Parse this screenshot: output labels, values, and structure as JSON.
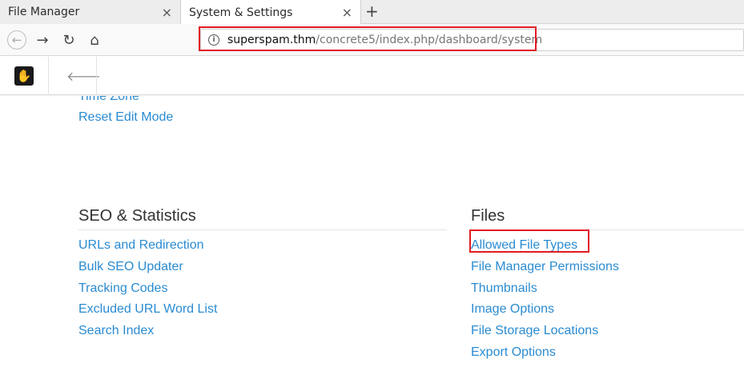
{
  "browser": {
    "tabs": [
      {
        "label": "File Manager",
        "close": "×"
      },
      {
        "label": "System & Settings",
        "close": "×"
      }
    ],
    "new_tab": "+",
    "nav": {
      "back": "←",
      "forward": "→",
      "reload": "↻",
      "home": "⌂"
    },
    "url_host": "superspam.thm",
    "url_path": "/concrete5/index.php/dashboard/system",
    "info_icon": "i"
  },
  "toolbar": {
    "logo": "✋",
    "back": "🡐"
  },
  "previous_section": {
    "links": [
      "Time Zone",
      "Reset Edit Mode"
    ]
  },
  "seo": {
    "title": "SEO & Statistics",
    "links": [
      "URLs and Redirection",
      "Bulk SEO Updater",
      "Tracking Codes",
      "Excluded URL Word List",
      "Search Index"
    ]
  },
  "files": {
    "title": "Files",
    "links": [
      "Allowed File Types",
      "File Manager Permissions",
      "Thumbnails",
      "Image Options",
      "File Storage Locations",
      "Export Options"
    ]
  },
  "colors": {
    "link": "#2a8bd1",
    "highlight": "#e01b24"
  }
}
